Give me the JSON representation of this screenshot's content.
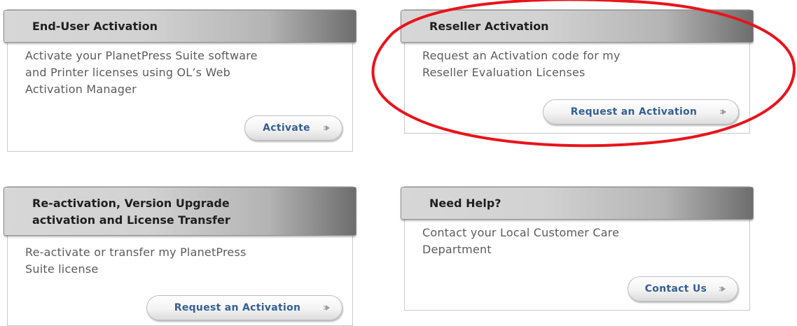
{
  "cards": {
    "end_user": {
      "title": "End-User Activation",
      "description": "Activate your PlanetPress Suite software\nand Printer licenses using OL’s Web\nActivation Manager",
      "button_label": "Activate"
    },
    "reseller": {
      "title": "Reseller Activation",
      "description": "Request an Activation code for my\nReseller Evaluation Licenses",
      "button_label": "Request an Activation"
    },
    "reactivation": {
      "title": "Re-activation, Version Upgrade\nactivation and License Transfer",
      "description": "Re-activate or transfer my PlanetPress\nSuite license",
      "button_label": "Request an Activation"
    },
    "help": {
      "title": "Need Help?",
      "description": "Contact your Local Customer Care\nDepartment",
      "button_label": "Contact Us"
    }
  },
  "icons": {
    "button_arrow": "chevron-right-icon"
  },
  "colors": {
    "annotation": "#e8141b",
    "button_text": "#355f95",
    "body_text": "#5c5c5c"
  }
}
